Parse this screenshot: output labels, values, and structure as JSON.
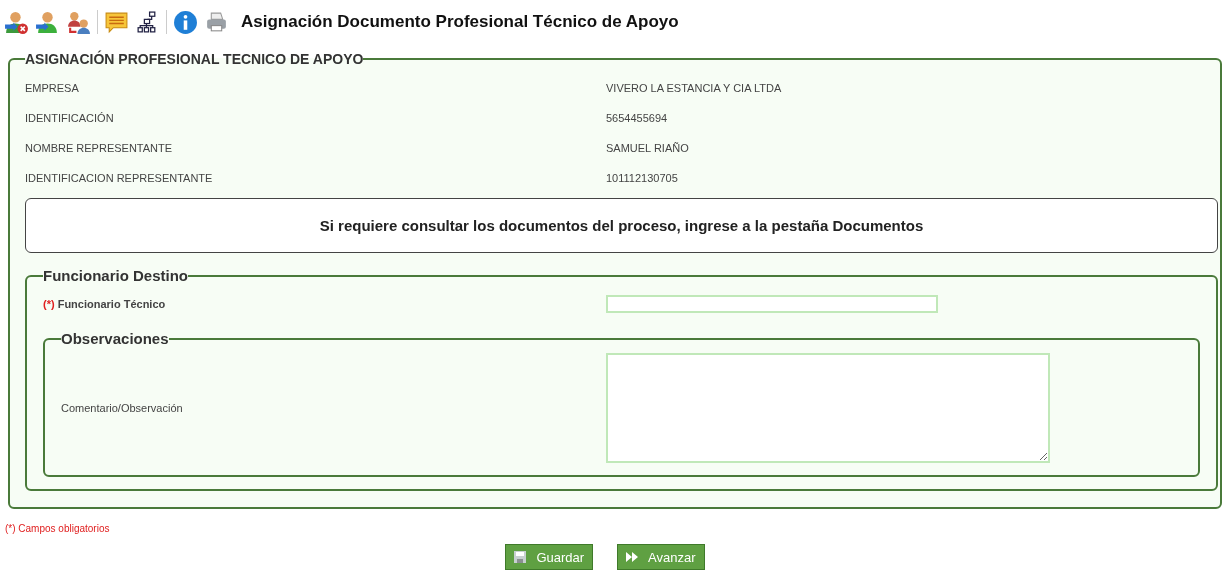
{
  "title": "Asignación Documento Profesional Técnico de Apoyo",
  "section": {
    "legend": "ASIGNACIÓN PROFESIONAL TECNICO DE APOYO",
    "rows": [
      {
        "label": "EMPRESA",
        "value": "VIVERO LA ESTANCIA Y CIA LTDA"
      },
      {
        "label": "IDENTIFICACIÓN",
        "value": "5654455694"
      },
      {
        "label": "NOMBRE REPRESENTANTE",
        "value": "SAMUEL RIAÑO"
      },
      {
        "label": "IDENTIFICACION REPRESENTANTE",
        "value": "101112130705"
      }
    ],
    "notice": "Si requiere consultar los documentos del proceso, ingrese a la pestaña Documentos",
    "destino": {
      "legend": "Funcionario Destino",
      "required_mark": "(*)",
      "field_label": "Funcionario Técnico",
      "observaciones": {
        "legend": "Observaciones",
        "field_label": "Comentario/Observación"
      }
    }
  },
  "footer_note": "(*) Campos obligatorios",
  "buttons": [
    {
      "kind": "save",
      "label": "Guardar"
    },
    {
      "kind": "forward",
      "label": "Avanzar"
    }
  ]
}
